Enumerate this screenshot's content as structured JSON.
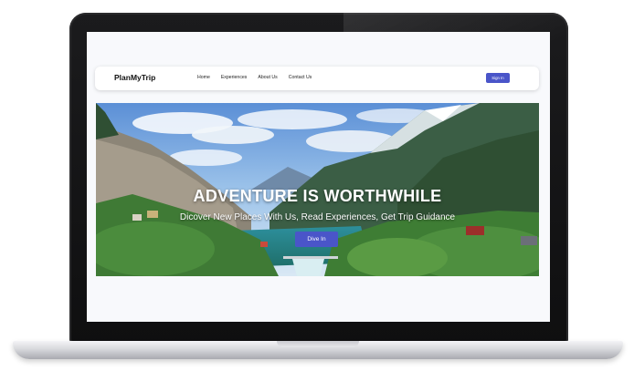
{
  "navbar": {
    "brand": "PlanMyTrip",
    "links": [
      "Home",
      "Experiences",
      "About Us",
      "Contact Us"
    ],
    "signin_label": "Sign In"
  },
  "hero": {
    "title": "ADVENTURE IS WORTHWHILE",
    "subtitle": "Dicover New Places With Us, Read Experiences, Get Trip Guidance",
    "cta_label": "Dive In"
  },
  "colors": {
    "accent": "#4a55c9",
    "laptop_frame": "#141415",
    "page_bg": "#f8f9fc"
  }
}
